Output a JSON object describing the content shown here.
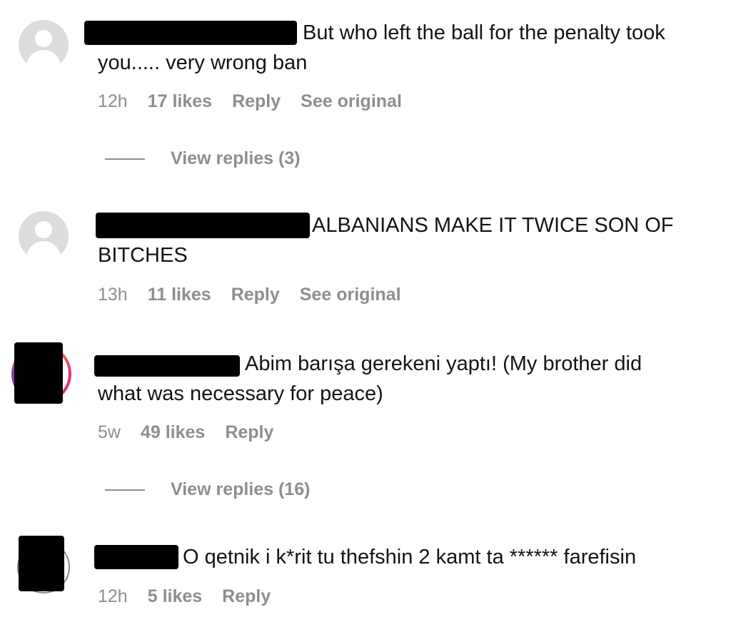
{
  "comments": [
    {
      "text_line1": "But who left the ball for the penalty took",
      "text_line2": "you..... very wrong ban",
      "time": "12h",
      "likes": "17 likes",
      "reply": "Reply",
      "see_original": "See original",
      "view_replies": "View replies (3)"
    },
    {
      "text_line1": "ALBANIANS MAKE IT TWICE SON OF",
      "text_line2": "BITCHES",
      "time": "13h",
      "likes": "11 likes",
      "reply": "Reply",
      "see_original": "See original"
    },
    {
      "text_line1": "Abim barışa gerekeni yaptı! (My brother did",
      "text_line2": "what was necessary for peace)",
      "time": "5w",
      "likes": "49 likes",
      "reply": "Reply",
      "view_replies": "View replies (16)"
    },
    {
      "text_line1": "O qetnik i k*rit tu thefshin 2 kamt ta ****** farefisin",
      "time": "12h",
      "likes": "5 likes",
      "reply": "Reply"
    }
  ]
}
